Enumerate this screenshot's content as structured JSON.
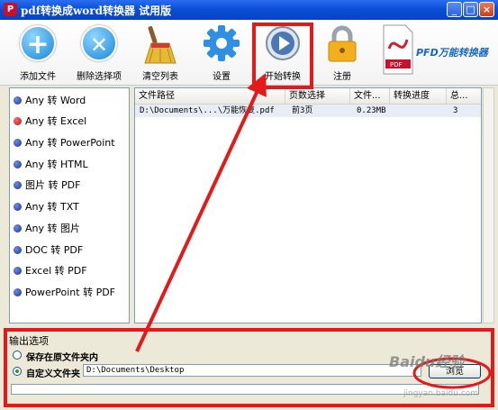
{
  "window": {
    "title": "pdf转换成word转换器 试用版",
    "app_icon": "pdf-app-icon",
    "controls": {
      "minimize": "_",
      "maximize": "□",
      "close": "×"
    }
  },
  "toolbar": {
    "items": [
      {
        "label": "添加文件",
        "icon": "add-icon",
        "glyph": "+"
      },
      {
        "label": "删除选择项",
        "icon": "delete-icon",
        "glyph": "✕"
      },
      {
        "label": "清空列表",
        "icon": "broom-icon"
      },
      {
        "label": "设置",
        "icon": "gear-icon"
      },
      {
        "label": "开始转换",
        "icon": "play-icon"
      },
      {
        "label": "注册",
        "icon": "lock-icon"
      }
    ],
    "brand": "PFD万能转换器"
  },
  "modes": [
    {
      "label": "Any 转 Word"
    },
    {
      "label": "Any 转 Excel"
    },
    {
      "label": "Any 转 PowerPoint"
    },
    {
      "label": "Any 转 HTML"
    },
    {
      "label": "图片 转 PDF"
    },
    {
      "label": "Any 转 TXT"
    },
    {
      "label": "Any 转 图片"
    },
    {
      "label": "DOC 转 PDF"
    },
    {
      "label": "Excel 转 PDF"
    },
    {
      "label": "PowerPoint 转 PDF"
    }
  ],
  "file_table": {
    "columns": [
      "文件路径",
      "页数选择",
      "文件...",
      "转换进度",
      "总..."
    ],
    "rows": [
      {
        "path": "D:\\Documents\\...\\万能恢复.pdf",
        "pages": "前3页",
        "size": "0.23MB",
        "progress": "",
        "total": "3"
      }
    ]
  },
  "output": {
    "legend": "输出选项",
    "option_same_folder": "保存在原文件夹内",
    "option_custom_folder": "自定义文件夹",
    "custom_path": "D:\\Documents\\Desktop",
    "browse_label": "浏览"
  },
  "watermark": {
    "text": "Baidu经验",
    "url": "jingyan.baidu.com"
  },
  "colors": {
    "annotation_red": "#e21a1a",
    "titlebar_blue": "#0a4fd6"
  }
}
